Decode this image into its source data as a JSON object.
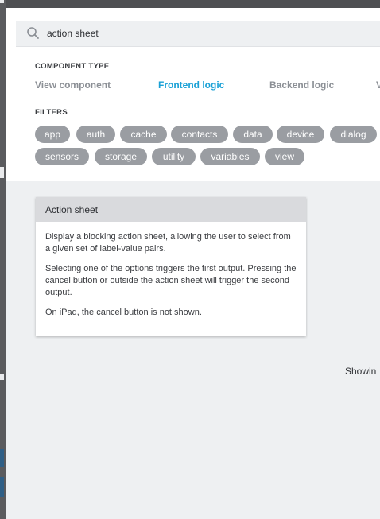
{
  "search": {
    "value": "action sheet"
  },
  "component_type": {
    "label": "COMPONENT TYPE",
    "tabs": [
      {
        "label": "View component",
        "active": false
      },
      {
        "label": "Frontend logic",
        "active": true
      },
      {
        "label": "Backend logic",
        "active": false
      }
    ]
  },
  "filters": {
    "label": "FILTERS",
    "row1": [
      "app",
      "auth",
      "cache",
      "contacts",
      "data",
      "device",
      "dialog"
    ],
    "row2": [
      "sensors",
      "storage",
      "utility",
      "variables",
      "view"
    ]
  },
  "result_card": {
    "title": "Action sheet",
    "paragraphs": [
      "Display a blocking action sheet, allowing the user to select from a given set of label-value pairs.",
      "Selecting one of the options triggers the first output. Pressing the cancel button or outside the action sheet will trigger the second output.",
      "On iPad, the cancel button is not shown."
    ]
  },
  "results_footer": {
    "text": "Showin"
  },
  "colors": {
    "accent": "#1aa1d6",
    "chip": "#9a9da2",
    "panel": "#eef0f2"
  }
}
